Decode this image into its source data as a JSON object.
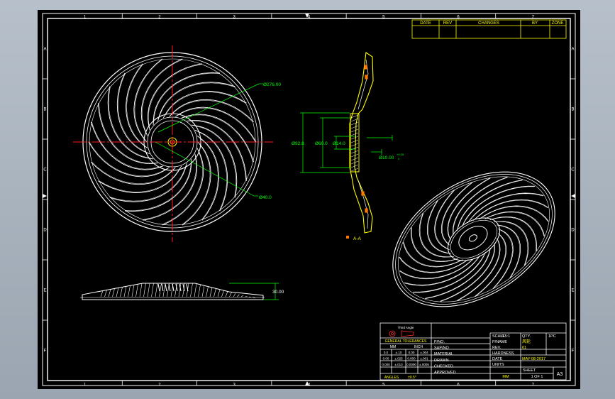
{
  "colors": {
    "background": "#000000",
    "geometry": "#ffffff",
    "dimension": "#00ff00",
    "centerline": "#ff0000",
    "revision_table": "#ffff00",
    "title_block": "#ffffff",
    "viewport": "#a9b3be"
  },
  "border": {
    "columns": [
      "1",
      "2",
      "3",
      "4",
      "5",
      "6",
      "7"
    ],
    "rows": [
      "A",
      "B",
      "C",
      "D",
      "E",
      "F"
    ]
  },
  "revision_table": {
    "headers": [
      "DATE",
      "REV",
      "CHANGES",
      "BY",
      "ZONE"
    ]
  },
  "dimensions": {
    "outer_dia": "Ø276.00",
    "hub_dia": "Ø40.0",
    "flange_dia": "Ø92.8",
    "boss_dia": "Ø60.0",
    "bore_dia": "Ø14.0",
    "bore_tol": "Ø10.00",
    "bore_tol_upper": "+0.05",
    "bore_tol_lower": "0",
    "height": "30.00",
    "section_label": "A-A"
  },
  "title_block": {
    "projection_label": "Third Angle",
    "general_tolerances": "GENERAL TOLERANCES",
    "tol_headers": [
      "MM",
      "INCH"
    ],
    "tol_rows": [
      [
        "0.0",
        "±.10",
        "0.00",
        "±.004"
      ],
      [
        "0.00",
        "±.025",
        "0.000",
        "±.001"
      ],
      [
        "0.000",
        "±.013",
        "0.0000",
        "±.0005"
      ]
    ],
    "angles_label": "ANGLES",
    "angles_value": "±0.5°",
    "left_labels": [
      "P/NO.",
      "SAP/NO",
      "MATERIAL",
      "DRAWN",
      "CHECKED",
      "APPROVED"
    ],
    "scale_label": "SCALE",
    "scale_value": "0.5:1",
    "qty_label": "QTY.",
    "qty_value": "1PC",
    "pname_label": "P/NAME",
    "pname_value": "风轮",
    "rev_label": "REV.",
    "rev_value": "01",
    "hardness_label": "HARDNESS",
    "date_label": "DATE",
    "date_value": "MAY-08-2017",
    "units_label": "UNITS",
    "units_value": "MM",
    "sheet_label": "SHEET",
    "sheet_value": "1 OF 1",
    "size_value": "A3"
  }
}
